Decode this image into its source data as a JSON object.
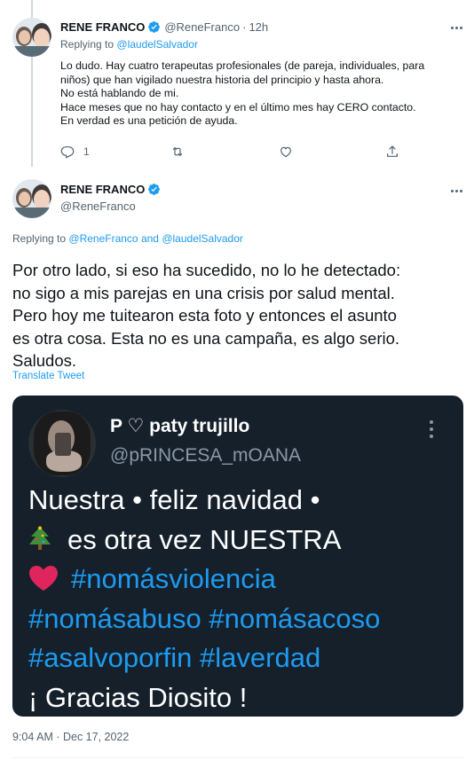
{
  "reply_tweet": {
    "display_name": "RENE FRANCO",
    "handle": "@ReneFranco",
    "separator": "·",
    "time": "12h",
    "replying_prefix": "Replying to",
    "replying_to": "@laudelSalvador",
    "lines": [
      "Lo dudo. Hay cuatro terapeutas profesionales (de pareja, individuales, para",
      "niños) que han vigilado nuestra historia del principio y hasta ahora.",
      "No está hablando de mi.",
      "Hace meses que no hay contacto y en el último mes hay CERO contacto.",
      "En verdad es una petición de ayuda."
    ],
    "reply_count": "1",
    "icons": [
      "reply-icon",
      "retweet-icon",
      "like-icon",
      "share-icon"
    ]
  },
  "main_tweet": {
    "display_name": "RENE FRANCO",
    "handle": "@ReneFranco",
    "replying_prefix": "Replying to",
    "replying_to_1": "@ReneFranco",
    "replying_and": "and",
    "replying_to_2": "@laudelSalvador",
    "lines": [
      "Por otro lado, si eso ha sucedido, no lo he detectado:",
      "no sigo a mis parejas en una crisis por salud mental.",
      "Pero hoy me tuitearon esta foto y entonces el asunto",
      "es otra cosa. Esta no es una campaña, es algo serio.",
      "Saludos."
    ],
    "translate_label": "Translate Tweet",
    "timestamp": "9:04 AM · Dec 17, 2022"
  },
  "embedded_image": {
    "display_name": "P ♡ paty trujillo",
    "handle": "@pRINCESA_mOANA",
    "line1": "Nuestra • feliz navidad •",
    "line2": "es otra vez NUESTRA",
    "line3_tag": "#nomásviolencia",
    "line4_tag1": "#nomásabuso",
    "line4_tag2": "#nomásacoso",
    "line5_tag1": "#asalvoporfin",
    "line5_tag2": "#laverdad",
    "line6": "¡ Gracias Diosito !"
  },
  "colors": {
    "accent": "#1d9bf0",
    "text": "#0f1419",
    "secondary": "#536471",
    "media_background": "#15202b"
  }
}
